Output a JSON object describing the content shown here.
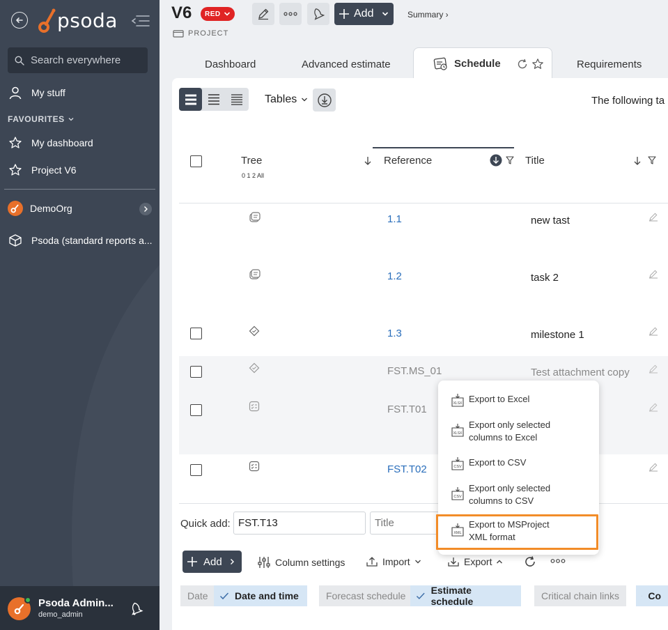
{
  "sidebar": {
    "logo_text": "psoda",
    "search_placeholder": "Search everywhere",
    "my_stuff": "My stuff",
    "favourites_heading": "FAVOURITES",
    "favourites": [
      {
        "label": "My dashboard"
      },
      {
        "label": "Project V6"
      }
    ],
    "org": "DemoOrg",
    "standard_reports": "Psoda (standard reports a...",
    "user_name": "Psoda Admin...",
    "user_login": "demo_admin"
  },
  "header": {
    "title": "V6",
    "status": "RED",
    "add_label": "Add",
    "summary_link": "Summary ›",
    "type_label": "PROJECT"
  },
  "tabs": [
    {
      "label": "Dashboard"
    },
    {
      "label": "Advanced estimate"
    },
    {
      "label": "Schedule",
      "active": true
    },
    {
      "label": "Requirements"
    }
  ],
  "toolbar": {
    "tables_label": "Tables",
    "following_text": "The following ta"
  },
  "table": {
    "columns": {
      "tree": "Tree",
      "tree_levels": "0 1 2 All",
      "reference": "Reference",
      "title": "Title"
    },
    "rows": [
      {
        "ref": "1.1",
        "title": "new tast"
      },
      {
        "ref": "1.2",
        "title": "task 2"
      },
      {
        "ref": "1.3",
        "title": "milestone 1"
      },
      {
        "ref": "FST.MS_01",
        "title": "Test attachment copy"
      },
      {
        "ref": "FST.T01",
        "title": ""
      },
      {
        "ref": "FST.T02",
        "title": ""
      }
    ]
  },
  "quick_add": {
    "label": "Quick add:",
    "reference_value": "FST.T13",
    "title_placeholder": "Title"
  },
  "bottom_bar": {
    "add": "Add",
    "column_settings": "Column settings",
    "import": "Import",
    "export": "Export"
  },
  "filters": [
    {
      "label": "Date",
      "on": false
    },
    {
      "label": "Date and time",
      "on": true
    },
    {
      "label": "Forecast schedule",
      "on": false
    },
    {
      "label": "Estimate schedule",
      "on": true
    },
    {
      "label": "Critical chain links",
      "on": false
    },
    {
      "label": "Co",
      "on": true
    }
  ],
  "export_menu": {
    "items": [
      {
        "line1": "Export to Excel",
        "line2": "",
        "icon": "xlsx-file-icon",
        "icon_text": "XLSX"
      },
      {
        "line1": "Export only selected",
        "line2": "columns to Excel",
        "icon": "xlsx-file-icon",
        "icon_text": "XLSX"
      },
      {
        "line1": "Export to CSV",
        "line2": "",
        "icon": "csv-file-icon",
        "icon_text": "CSV"
      },
      {
        "line1": "Export only selected",
        "line2": "columns to CSV",
        "icon": "csv-file-icon",
        "icon_text": "CSV"
      },
      {
        "line1": "Export to MSProject",
        "line2": "XML format",
        "icon": "xml-file-icon",
        "icon_text": "XML",
        "highlighted": true
      }
    ]
  },
  "colors": {
    "sidebar_bg": "#3d4654",
    "accent_orange": "#e8702a",
    "status_red": "#e02424",
    "link_blue": "#2a6ebb",
    "highlight_orange": "#f28c28"
  }
}
